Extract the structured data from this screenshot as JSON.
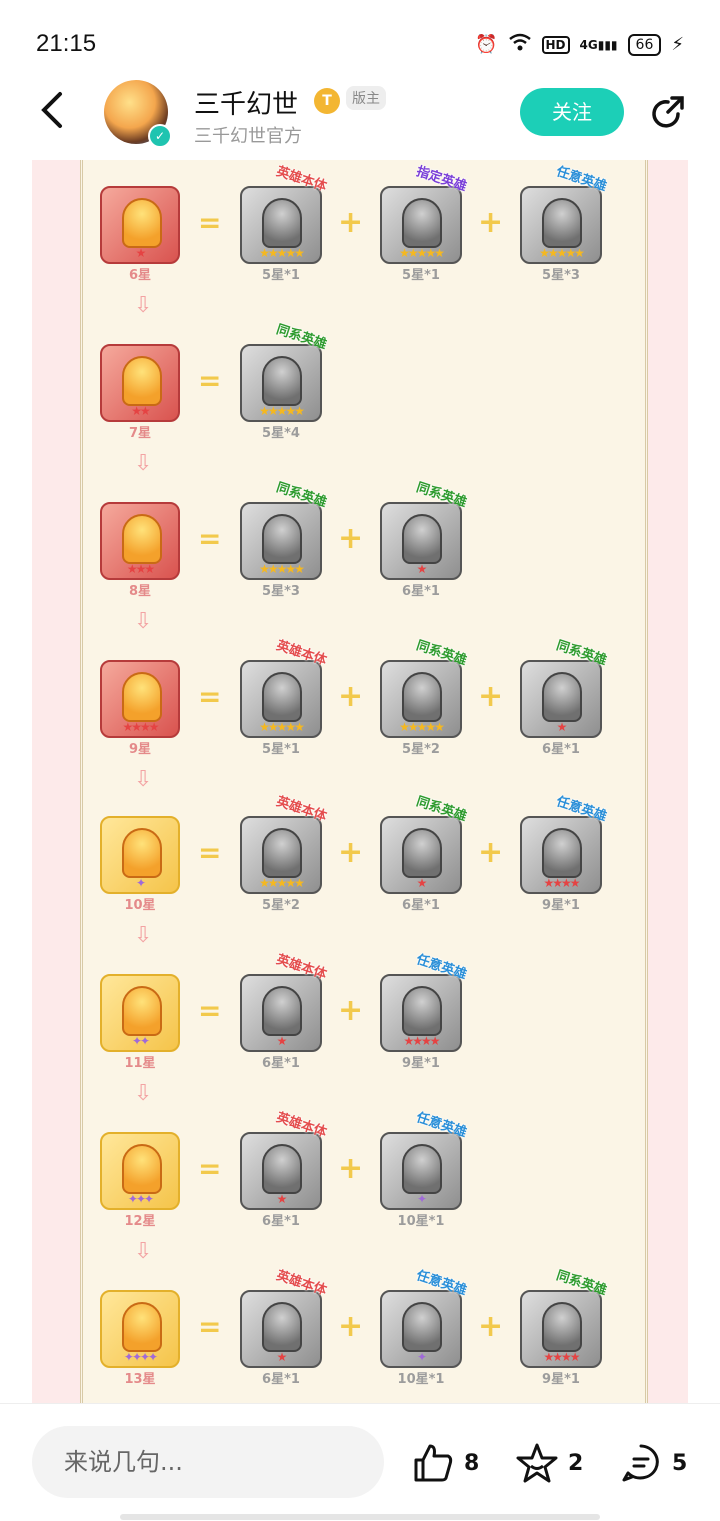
{
  "status": {
    "time": "21:15",
    "hd": "HD",
    "net": "4G",
    "battery": "66"
  },
  "header": {
    "name": "三千幻世",
    "level": "T",
    "role": "版主",
    "subname": "三千幻世官方",
    "follow": "关注"
  },
  "rows": [
    {
      "result": "6星",
      "result_stars": "★",
      "gold": false,
      "materials": [
        {
          "tag": "英雄本体",
          "tag_color": "red",
          "stars": "★★★★★",
          "star_color": "gold",
          "label": "5星*1"
        },
        {
          "tag": "指定英雄",
          "tag_color": "purple",
          "stars": "★★★★★",
          "star_color": "gold",
          "label": "5星*1"
        },
        {
          "tag": "任意英雄",
          "tag_color": "blue",
          "stars": "★★★★★",
          "star_color": "gold",
          "label": "5星*3"
        }
      ]
    },
    {
      "result": "7星",
      "result_stars": "★★",
      "gold": false,
      "materials": [
        {
          "tag": "同系英雄",
          "tag_color": "green",
          "stars": "★★★★★",
          "star_color": "gold",
          "label": "5星*4"
        }
      ]
    },
    {
      "result": "8星",
      "result_stars": "★★★",
      "gold": false,
      "materials": [
        {
          "tag": "同系英雄",
          "tag_color": "green",
          "stars": "★★★★★",
          "star_color": "gold",
          "label": "5星*3"
        },
        {
          "tag": "同系英雄",
          "tag_color": "green",
          "stars": "★",
          "star_color": "red",
          "label": "6星*1"
        }
      ]
    },
    {
      "result": "9星",
      "result_stars": "★★★★",
      "gold": false,
      "materials": [
        {
          "tag": "英雄本体",
          "tag_color": "red",
          "stars": "★★★★★",
          "star_color": "gold",
          "label": "5星*1"
        },
        {
          "tag": "同系英雄",
          "tag_color": "green",
          "stars": "★★★★★",
          "star_color": "gold",
          "label": "5星*2"
        },
        {
          "tag": "同系英雄",
          "tag_color": "green",
          "stars": "★",
          "star_color": "red",
          "label": "6星*1"
        }
      ]
    },
    {
      "result": "10星",
      "result_stars": "✦",
      "gold": true,
      "materials": [
        {
          "tag": "英雄本体",
          "tag_color": "red",
          "stars": "★★★★★",
          "star_color": "gold",
          "label": "5星*2"
        },
        {
          "tag": "同系英雄",
          "tag_color": "green",
          "stars": "★",
          "star_color": "red",
          "label": "6星*1"
        },
        {
          "tag": "任意英雄",
          "tag_color": "blue",
          "stars": "★★★★",
          "star_color": "red",
          "label": "9星*1"
        }
      ]
    },
    {
      "result": "11星",
      "result_stars": "✦✦",
      "gold": true,
      "materials": [
        {
          "tag": "英雄本体",
          "tag_color": "red",
          "stars": "★",
          "star_color": "red",
          "label": "6星*1"
        },
        {
          "tag": "任意英雄",
          "tag_color": "blue",
          "stars": "★★★★",
          "star_color": "red",
          "label": "9星*1"
        }
      ]
    },
    {
      "result": "12星",
      "result_stars": "✦✦✦",
      "gold": true,
      "materials": [
        {
          "tag": "英雄本体",
          "tag_color": "red",
          "stars": "★",
          "star_color": "red",
          "label": "6星*1"
        },
        {
          "tag": "任意英雄",
          "tag_color": "blue",
          "stars": "✦",
          "star_color": "purple",
          "label": "10星*1"
        }
      ]
    },
    {
      "result": "13星",
      "result_stars": "✦✦✦✦",
      "gold": true,
      "materials": [
        {
          "tag": "英雄本体",
          "tag_color": "red",
          "stars": "★",
          "star_color": "red",
          "label": "6星*1"
        },
        {
          "tag": "任意英雄",
          "tag_color": "blue",
          "stars": "✦",
          "star_color": "purple",
          "label": "10星*1"
        },
        {
          "tag": "同系英雄",
          "tag_color": "green",
          "stars": "★★★★",
          "star_color": "red",
          "label": "9星*1"
        }
      ]
    }
  ],
  "bottom": {
    "placeholder": "来说几句...",
    "likes": "8",
    "favorites": "2",
    "comments": "5"
  },
  "colors": {
    "accent": "#1ccfb7",
    "page_bg": "#fdeaea",
    "paper": "#fbf5e6"
  }
}
